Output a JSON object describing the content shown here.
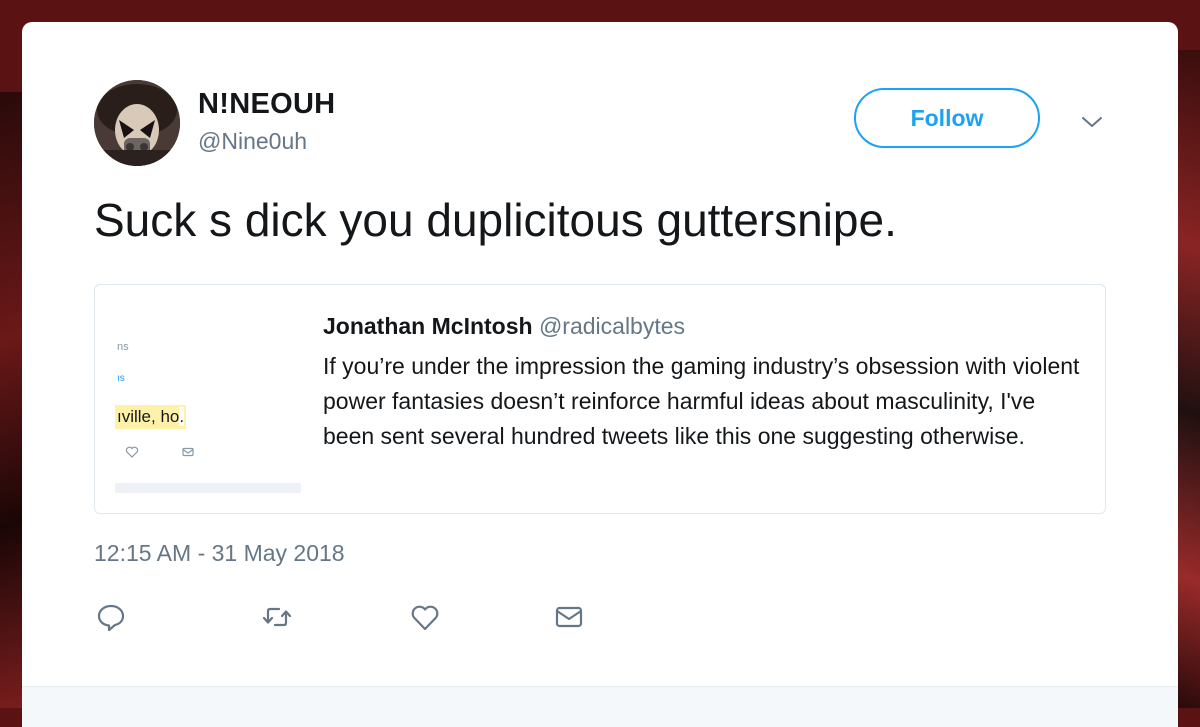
{
  "tweet": {
    "display_name": "N!NEOUH",
    "handle": "@Nine0uh",
    "follow_label": "Follow",
    "text": "Suck s dick you duplicitous guttersnipe.",
    "timestamp": "12:15 AM - 31 May 2018"
  },
  "quoted_tweet": {
    "name": "Jonathan McIntosh",
    "handle": "@radicalbytes",
    "text": "If you’re under the impression the gaming industry’s obsession with violent power fantasies doesn’t reinforce harmful ideas about masculinity, I've been sent several hundred tweets like this one suggesting otherwise.",
    "media": {
      "fragment_1": "ns",
      "fragment_2": "ıs",
      "highlight": "ıville, ho",
      "highlight_suffix": "."
    }
  },
  "actions": [
    {
      "icon": "reply-icon"
    },
    {
      "icon": "retweet-icon"
    },
    {
      "icon": "like-icon"
    },
    {
      "icon": "direct-message-icon"
    }
  ],
  "colors": {
    "accent": "#1da1f2",
    "text": "#14171a",
    "secondary": "#657786",
    "background": "#5a1212"
  }
}
